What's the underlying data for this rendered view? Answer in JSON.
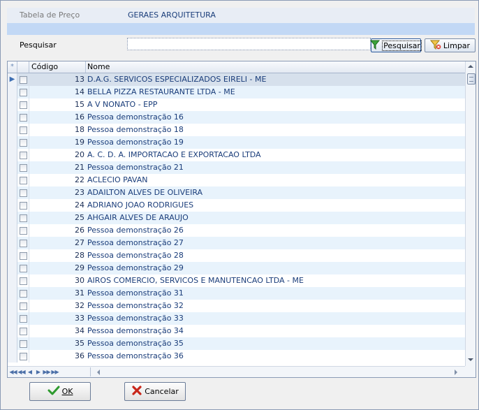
{
  "header": {
    "price_table_label": "Tabela de Preço",
    "price_table_value": "GERAES ARQUITETURA"
  },
  "search": {
    "label": "Pesquisar",
    "value": "",
    "search_button": "Pesquisar",
    "clear_button": "Limpar"
  },
  "grid": {
    "columns": {
      "indicator": "*",
      "code": "Código",
      "name": "Nome"
    },
    "selected_row": 0,
    "rows": [
      {
        "code": "13",
        "name": "D.A.G. SERVICOS ESPECIALIZADOS EIRELI  - ME"
      },
      {
        "code": "14",
        "name": "BELLA PIZZA RESTAURANTE LTDA - ME"
      },
      {
        "code": "15",
        "name": "A V NONATO - EPP"
      },
      {
        "code": "16",
        "name": "Pessoa demonstração 16"
      },
      {
        "code": "18",
        "name": "Pessoa demonstração 18"
      },
      {
        "code": "19",
        "name": "Pessoa demonstração 19"
      },
      {
        "code": "20",
        "name": "A. C. D. A. IMPORTACAO E EXPORTACAO LTDA"
      },
      {
        "code": "21",
        "name": "Pessoa demonstração 21"
      },
      {
        "code": "22",
        "name": "ACLECIO PAVAN"
      },
      {
        "code": "23",
        "name": "ADAILTON ALVES DE OLIVEIRA"
      },
      {
        "code": "24",
        "name": "ADRIANO JOAO RODRIGUES"
      },
      {
        "code": "25",
        "name": "AHGAIR ALVES DE ARAUJO"
      },
      {
        "code": "26",
        "name": "Pessoa demonstração 26"
      },
      {
        "code": "27",
        "name": "Pessoa demonstração 27"
      },
      {
        "code": "28",
        "name": "Pessoa demonstração 28"
      },
      {
        "code": "29",
        "name": "Pessoa demonstração 29"
      },
      {
        "code": "30",
        "name": "AIROS COMERCIO, SERVICOS E MANUTENCAO LTDA - ME"
      },
      {
        "code": "31",
        "name": "Pessoa demonstração 31"
      },
      {
        "code": "32",
        "name": "Pessoa demonstração 32"
      },
      {
        "code": "33",
        "name": "Pessoa demonstração 33"
      },
      {
        "code": "34",
        "name": "Pessoa demonstração 34"
      },
      {
        "code": "35",
        "name": "Pessoa demonstração 35"
      },
      {
        "code": "36",
        "name": "Pessoa demonstração 36"
      }
    ]
  },
  "footer": {
    "ok_label": "OK",
    "cancel_label": "Cancelar"
  },
  "icons": {
    "filter": "filter-icon",
    "clear_filter": "clear-filter-icon",
    "check": "check-icon",
    "cross": "cross-icon",
    "row_pointer": "row-pointer-icon"
  },
  "colors": {
    "accent": "#c2d8f5",
    "alt_row": "#e8f3fc",
    "name_text": "#1a3d7a"
  }
}
